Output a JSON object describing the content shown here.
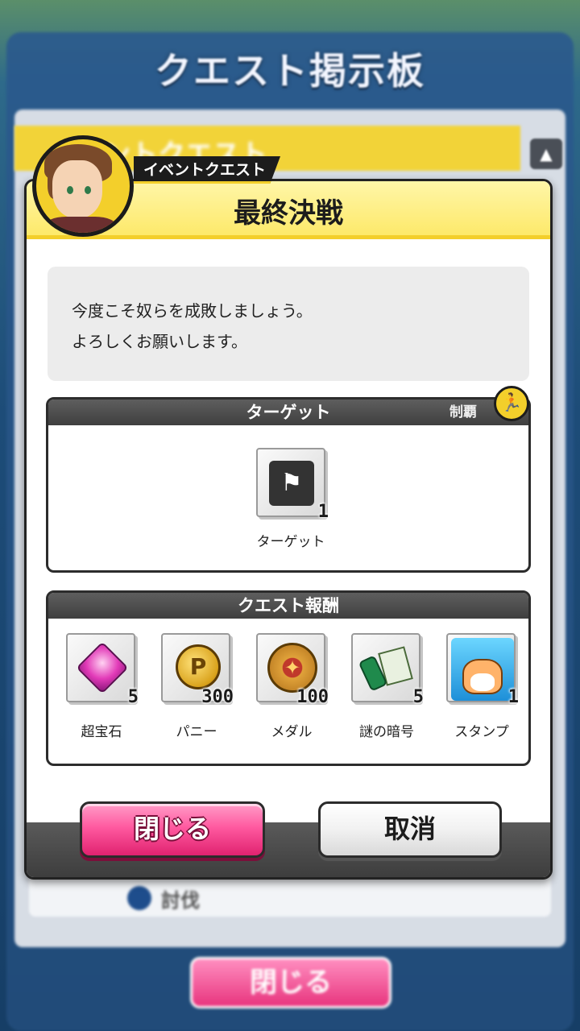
{
  "background": {
    "board_title": "クエスト掲示板",
    "banner_text": "イベントクエスト",
    "scroll_glyph": "▲",
    "list_item_label": "討伐",
    "close_label": "閉じる"
  },
  "dialog": {
    "tag_label": "イベントクエスト",
    "title": "最終決戦",
    "message_lines": [
      "今度こそ奴らを成敗しましょう。",
      "よろしくお願いします。"
    ],
    "target_section": {
      "header": "ターゲット",
      "sub_label": "制覇",
      "badge_icon": "runner-icon",
      "items": [
        {
          "icon": "flag-runner-icon",
          "count": "1",
          "label": "ターゲット"
        }
      ]
    },
    "reward_section": {
      "header": "クエスト報酬",
      "items": [
        {
          "icon": "gem-icon",
          "count": "5",
          "label": "超宝石"
        },
        {
          "icon": "coin-icon",
          "count": "300",
          "label": "パニー"
        },
        {
          "icon": "medal-icon",
          "count": "100",
          "label": "メダル"
        },
        {
          "icon": "scroll-icon",
          "count": "5",
          "label": "謎の暗号"
        },
        {
          "icon": "stamp-icon",
          "count": "1",
          "label": "スタンプ"
        }
      ]
    },
    "buttons": {
      "close_label": "閉じる",
      "cancel_label": "取消"
    }
  },
  "colors": {
    "accent_yellow": "#f3cf2b",
    "button_pink": "#ff5aa0",
    "section_header": "#3f3f3f"
  }
}
